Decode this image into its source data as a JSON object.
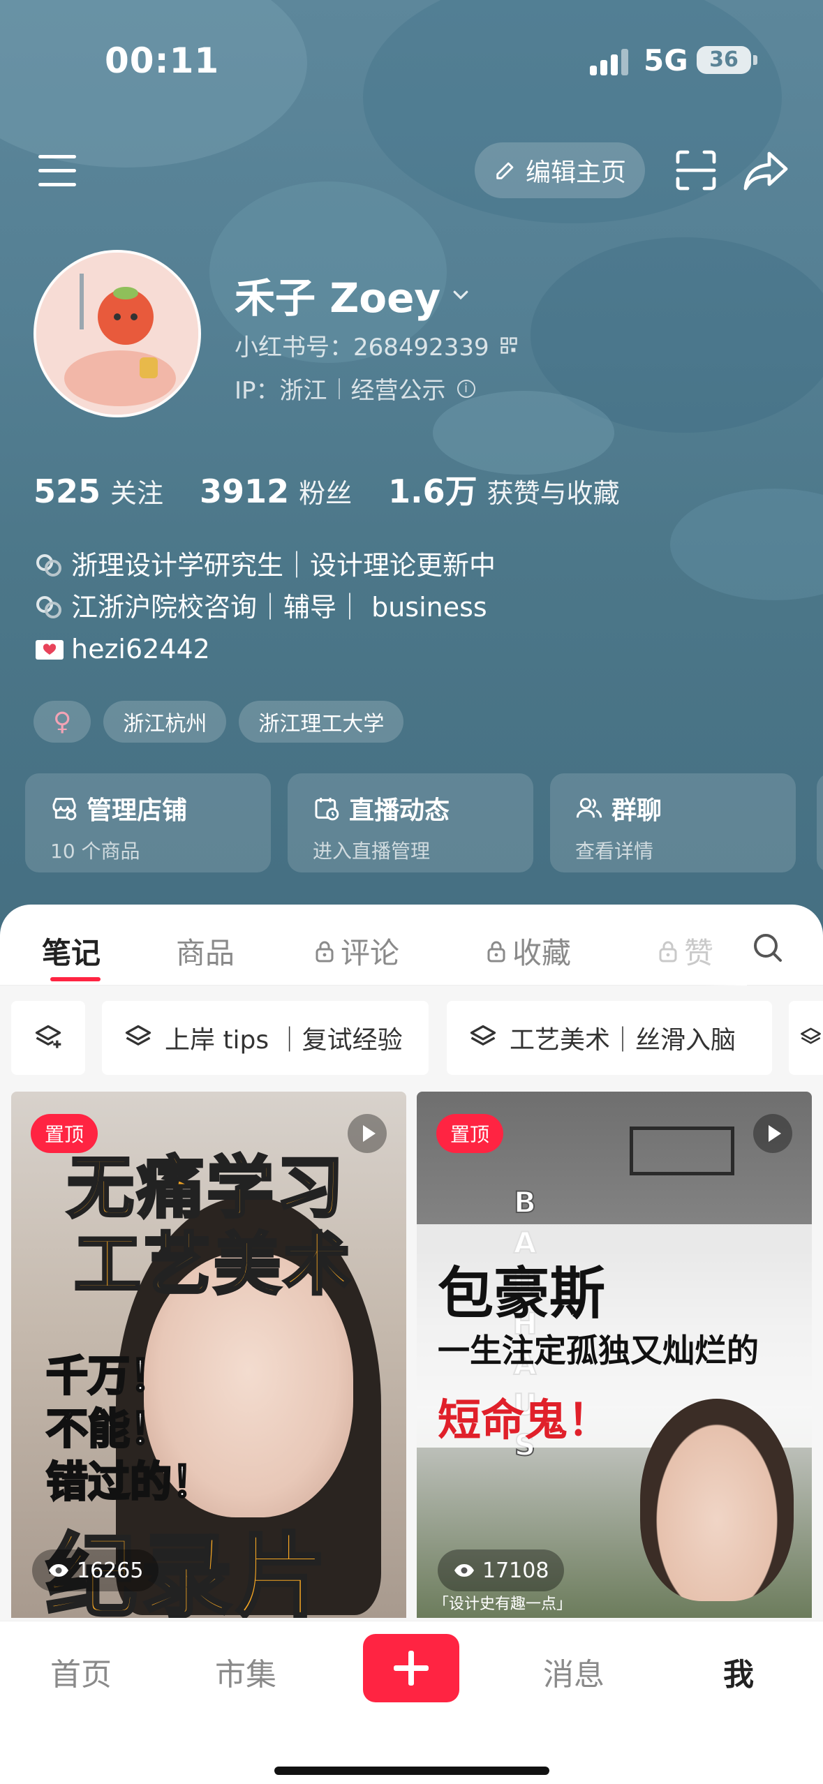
{
  "status_bar": {
    "time": "00:11",
    "network": "5G",
    "battery": "36"
  },
  "topbar": {
    "edit_label": "编辑主页"
  },
  "profile": {
    "name": "禾子 Zoey",
    "id_label": "小红书号：268492339",
    "ip_label": "IP：浙江",
    "business_label": "经营公示"
  },
  "stats": [
    {
      "num": "525",
      "label": "关注"
    },
    {
      "num": "3912",
      "label": "粉丝"
    },
    {
      "num": "1.6万",
      "label": "获赞与收藏"
    }
  ],
  "bio": {
    "line1": "浙理设计学研究生｜设计理论更新中",
    "line2": "江浙沪院校咨询｜辅导｜ business",
    "line3": "hezi62442"
  },
  "tags": {
    "gender": "♀",
    "city": "浙江杭州",
    "school": "浙江理工大学"
  },
  "cards": [
    {
      "title": "管理店铺",
      "sub": "10 个商品"
    },
    {
      "title": "直播动态",
      "sub": "进入直播管理"
    },
    {
      "title": "群聊",
      "sub": "查看详情"
    }
  ],
  "tabs": {
    "notes": "笔记",
    "goods": "商品",
    "comments": "评论",
    "collects": "收藏",
    "likes": "赞"
  },
  "filters": {
    "chip1": "上岸 tips ｜复试经验",
    "chip2": "工艺美术｜丝滑入脑"
  },
  "notes": [
    {
      "pin": "置顶",
      "title_l1": "无痛学习",
      "title_l2": "工艺美术",
      "side": "千万！\n不能！\n错过的！",
      "big": "纪录片",
      "views": "16265"
    },
    {
      "pin": "置顶",
      "vertical": "BAUHAUS",
      "title_l1": "包豪斯",
      "title_l2": "一生注定孤独又灿烂的",
      "title_l3": "短命鬼！",
      "views": "17108",
      "caption": "「设计史有趣一点」"
    }
  ],
  "bottom_nav": {
    "home": "首页",
    "market": "市集",
    "messages": "消息",
    "me": "我"
  },
  "colors": {
    "accent": "#ff2442",
    "hero_bg": "#547f93"
  }
}
